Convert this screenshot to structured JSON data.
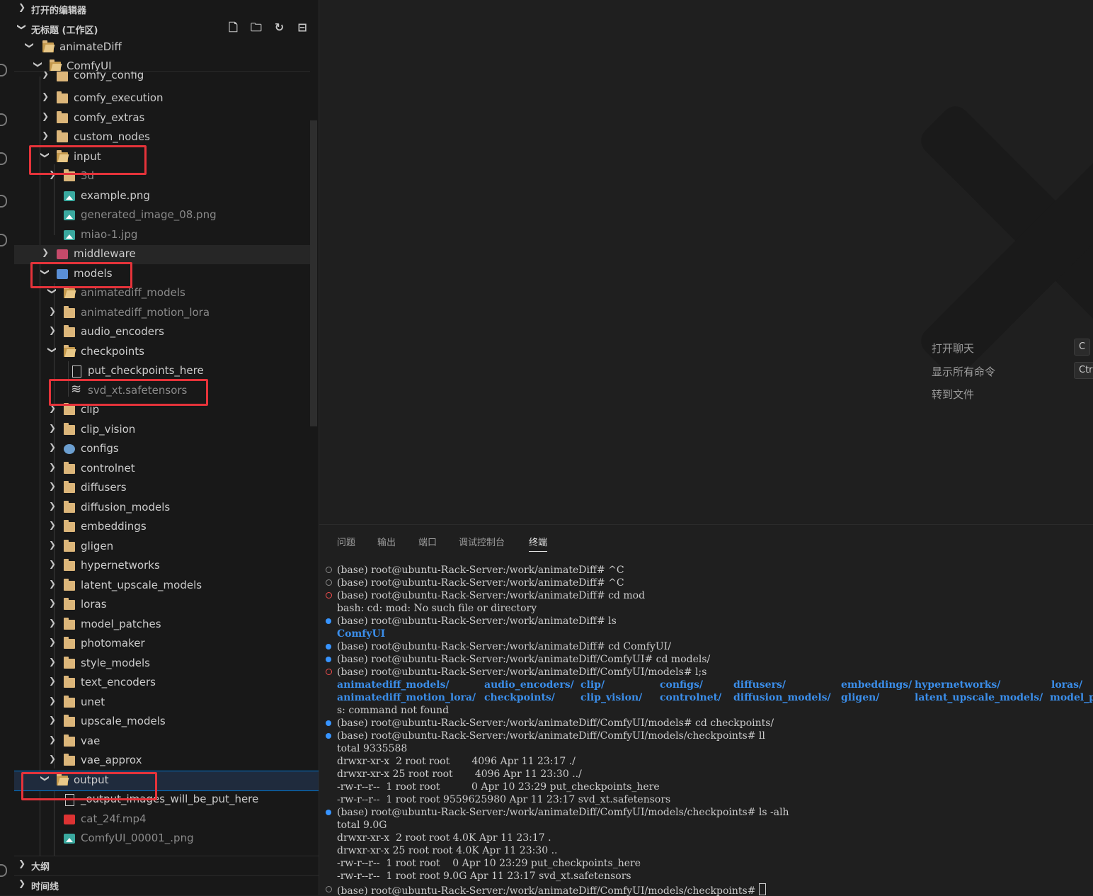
{
  "sidebar": {
    "open_editors": "打开的编辑器",
    "workspace": "无标题 (工作区)",
    "outline": "大纲",
    "timeline": "时间线",
    "tree": {
      "animateDiff": "animateDiff",
      "comfyui": "ComfyUI",
      "comfy_config": "comfy_config",
      "comfy_execution": "comfy_execution",
      "comfy_extras": "comfy_extras",
      "custom_nodes": "custom_nodes",
      "input": "input",
      "input_3d": "3d",
      "example_png": "example.png",
      "generated_image": "generated_image_08.png",
      "miao": "miao-1.jpg",
      "middleware": "middleware",
      "models": "models",
      "animatediff_models": "animatediff_models",
      "animatediff_motion_lora": "animatediff_motion_lora",
      "audio_encoders": "audio_encoders",
      "checkpoints": "checkpoints",
      "put_checkpoints_here": "put_checkpoints_here",
      "svd_xt": "svd_xt.safetensors",
      "clip": "clip",
      "clip_vision": "clip_vision",
      "configs": "configs",
      "controlnet": "controlnet",
      "diffusers": "diffusers",
      "diffusion_models": "diffusion_models",
      "embeddings": "embeddings",
      "gligen": "gligen",
      "hypernetworks": "hypernetworks",
      "latent_upscale_models": "latent_upscale_models",
      "loras": "loras",
      "model_patches": "model_patches",
      "photomaker": "photomaker",
      "style_models": "style_models",
      "text_encoders": "text_encoders",
      "unet": "unet",
      "upscale_models": "upscale_models",
      "vae": "vae",
      "vae_approx": "vae_approx",
      "output": "output",
      "output_images": "_output_images_will_be_put_here",
      "cat": "cat_24f.mp4",
      "comfyui_00001": "ComfyUI_00001_.png"
    }
  },
  "editor": {
    "cmd_open_chat": "打开聊天",
    "cmd_show_all": "显示所有命令",
    "cmd_goto_file": "转到文件",
    "kbd1": "C",
    "kbd2": "Ctrl"
  },
  "panel": {
    "tabs": [
      "问题",
      "输出",
      "端口",
      "调试控制台",
      "终端"
    ],
    "terminal": [
      "(base) root@ubuntu-Rack-Server:/work/animateDiff# ^C",
      "(base) root@ubuntu-Rack-Server:/work/animateDiff# ^C",
      "(base) root@ubuntu-Rack-Server:/work/animateDiff# cd mod",
      "bash: cd: mod: No such file or directory",
      "(base) root@ubuntu-Rack-Server:/work/animateDiff# ls",
      "ComfyUI",
      "(base) root@ubuntu-Rack-Server:/work/animateDiff# cd ComfyUI/",
      "(base) root@ubuntu-Rack-Server:/work/animateDiff/ComfyUI# cd models/",
      "(base) root@ubuntu-Rack-Server:/work/animateDiff/ComfyUI/models# l;s",
      "s: command not found",
      "(base) root@ubuntu-Rack-Server:/work/animateDiff/ComfyUI/models# cd checkpoints/",
      "(base) root@ubuntu-Rack-Server:/work/animateDiff/ComfyUI/models/checkpoints# ll",
      "total 9335588",
      "drwxr-xr-x  2 root root       4096 Apr 11 23:17 ./",
      "drwxr-xr-x 25 root root       4096 Apr 11 23:30 ../",
      "-rw-r--r--  1 root root          0 Apr 10 23:29 put_checkpoints_here",
      "-rw-r--r--  1 root root 9559625980 Apr 11 23:17 svd_xt.safetensors",
      "(base) root@ubuntu-Rack-Server:/work/animateDiff/ComfyUI/models/checkpoints# ls -alh",
      "total 9.0G",
      "drwxr-xr-x  2 root root 4.0K Apr 11 23:17 .",
      "drwxr-xr-x 25 root root 4.0K Apr 11 23:30 ..",
      "-rw-r--r--  1 root root    0 Apr 10 23:29 put_checkpoints_here",
      "-rw-r--r--  1 root root 9.0G Apr 11 23:17 svd_xt.safetensors",
      "(base) root@ubuntu-Rack-Server:/work/animateDiff/ComfyUI/models/checkpoints# "
    ],
    "ls_dirs_row1": [
      "animatediff_models/",
      "audio_encoders/",
      "clip/",
      "configs/",
      "diffusers/",
      "embeddings/",
      "hypernetworks/",
      "loras/"
    ],
    "ls_dirs_row2": [
      "animatediff_motion_lora/",
      "checkpoints/",
      "clip_vision/",
      "controlnet/",
      "diffusion_models/",
      "gligen/",
      "latent_upscale_models/",
      "model_pa"
    ]
  },
  "colors": {
    "accent": "#0078d4",
    "highlight_box": "#e5333a",
    "folder": "#dcb67a",
    "dir_text": "#3b8eea"
  }
}
